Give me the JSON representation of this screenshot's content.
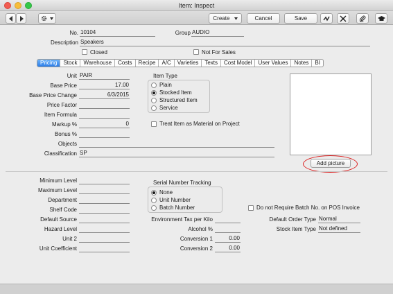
{
  "window": {
    "title": "Item: Inspect"
  },
  "toolbar": {
    "create_label": "Create",
    "cancel_label": "Cancel",
    "save_label": "Save"
  },
  "header": {
    "no_label": "No.",
    "no_value": "10104",
    "group_label": "Group",
    "group_value": "AUDIO",
    "description_label": "Description",
    "description_value": "Speakers",
    "closed_label": "Closed",
    "closed_checked": false,
    "not_for_sales_label": "Not For Sales",
    "not_for_sales_checked": false
  },
  "tabs": [
    {
      "label": "Pricing",
      "active": true
    },
    {
      "label": "Stock"
    },
    {
      "label": "Warehouse"
    },
    {
      "label": "Costs"
    },
    {
      "label": "Recipe"
    },
    {
      "label": "A/C"
    },
    {
      "label": "Varieties"
    },
    {
      "label": "Texts"
    },
    {
      "label": "Cost Model"
    },
    {
      "label": "User Values"
    },
    {
      "label": "Notes"
    },
    {
      "label": "BI"
    }
  ],
  "pricing": {
    "unit_label": "Unit",
    "unit_value": "PAIR",
    "base_price_label": "Base Price",
    "base_price_value": "17.00",
    "base_price_change_label": "Base Price Change",
    "base_price_change_value": "6/3/2015",
    "price_factor_label": "Price Factor",
    "price_factor_value": "",
    "item_formula_label": "Item Formula",
    "item_formula_value": "",
    "markup_label": "Markup %",
    "markup_value": "0",
    "bonus_label": "Bonus %",
    "bonus_value": "",
    "objects_label": "Objects",
    "objects_value": "",
    "classification_label": "Classification",
    "classification_value": "SP",
    "item_type_title": "Item Type",
    "item_types": [
      {
        "label": "Plain",
        "selected": false
      },
      {
        "label": "Stocked Item",
        "selected": true
      },
      {
        "label": "Structured Item",
        "selected": false
      },
      {
        "label": "Service",
        "selected": false
      }
    ],
    "treat_material_label": "Treat Item as Material on Project",
    "treat_material_checked": false,
    "add_picture_label": "Add picture"
  },
  "stock": {
    "minimum_level_label": "Minimum Level",
    "minimum_level_value": "",
    "maximum_level_label": "Maximum Level",
    "maximum_level_value": "",
    "department_label": "Department",
    "department_value": "",
    "shelf_code_label": "Shelf Code",
    "shelf_code_value": "",
    "default_source_label": "Default Source",
    "default_source_value": "",
    "hazard_level_label": "Hazard Level",
    "hazard_level_value": "",
    "unit2_label": "Unit 2",
    "unit2_value": "",
    "unit_coefficient_label": "Unit Coefficient",
    "unit_coefficient_value": "",
    "serial_title": "Serial Number Tracking",
    "serial_options": [
      {
        "label": "None",
        "selected": true
      },
      {
        "label": "Unit Number",
        "selected": false
      },
      {
        "label": "Batch Number",
        "selected": false
      }
    ],
    "env_tax_label": "Environment Tax per Kilo",
    "env_tax_value": "",
    "alcohol_label": "Alcohol %",
    "alcohol_value": "",
    "conversion1_label": "Conversion 1",
    "conversion1_value": "0.00",
    "conversion2_label": "Conversion 2",
    "conversion2_value": "0.00",
    "no_batch_pos_label": "Do not Require Batch No. on POS Invoice",
    "no_batch_pos_checked": false,
    "default_order_type_label": "Default Order Type",
    "default_order_type_value": "Normal",
    "stock_item_type_label": "Stock Item Type",
    "stock_item_type_value": "Not defined"
  }
}
